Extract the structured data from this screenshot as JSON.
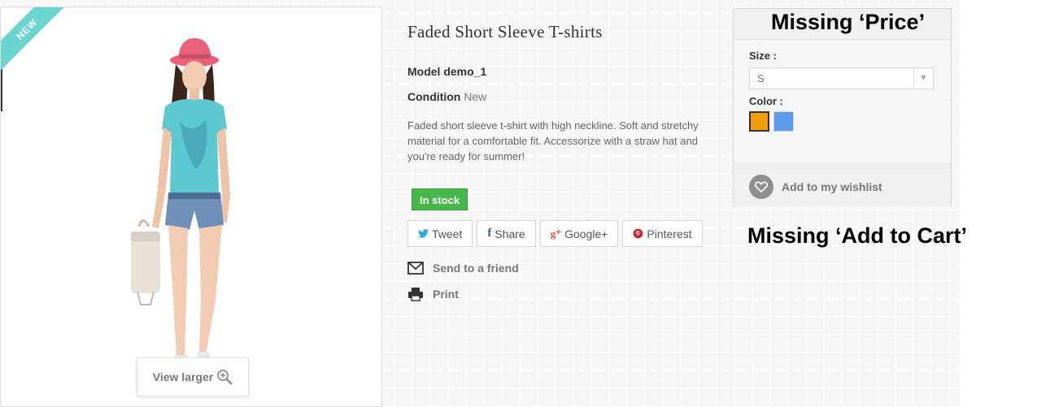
{
  "product": {
    "badge": "NEW",
    "view_larger": "View larger",
    "title": "Faded Short Sleeve T-shirts",
    "model_label": "Model",
    "model_value": "demo_1",
    "condition_label": "Condition",
    "condition_value": "New",
    "description": "Faded short sleeve t-shirt with high neckline. Soft and stretchy material for a comfortable fit. Accessorize with a straw hat and you're ready for summer!",
    "stock": "In stock"
  },
  "social": {
    "tweet": "Tweet",
    "share": "Share",
    "google": "Google+",
    "pinterest": "Pinterest",
    "google_icon": "g⁺",
    "facebook_icon": "f"
  },
  "actions": {
    "send_to_friend": "Send to a friend",
    "print": "Print"
  },
  "options": {
    "size_label": "Size :",
    "size_value": "S",
    "color_label": "Color :",
    "colors": [
      "#f39c11",
      "#5d9cec"
    ],
    "wishlist": "Add to my wishlist"
  },
  "annotations": {
    "missing_price": "Missing ‘Price’",
    "missing_cart": "Missing ‘Add to Cart’"
  },
  "colors": {
    "ribbon": "#6ad4cf",
    "in_stock": "#46b74a"
  }
}
